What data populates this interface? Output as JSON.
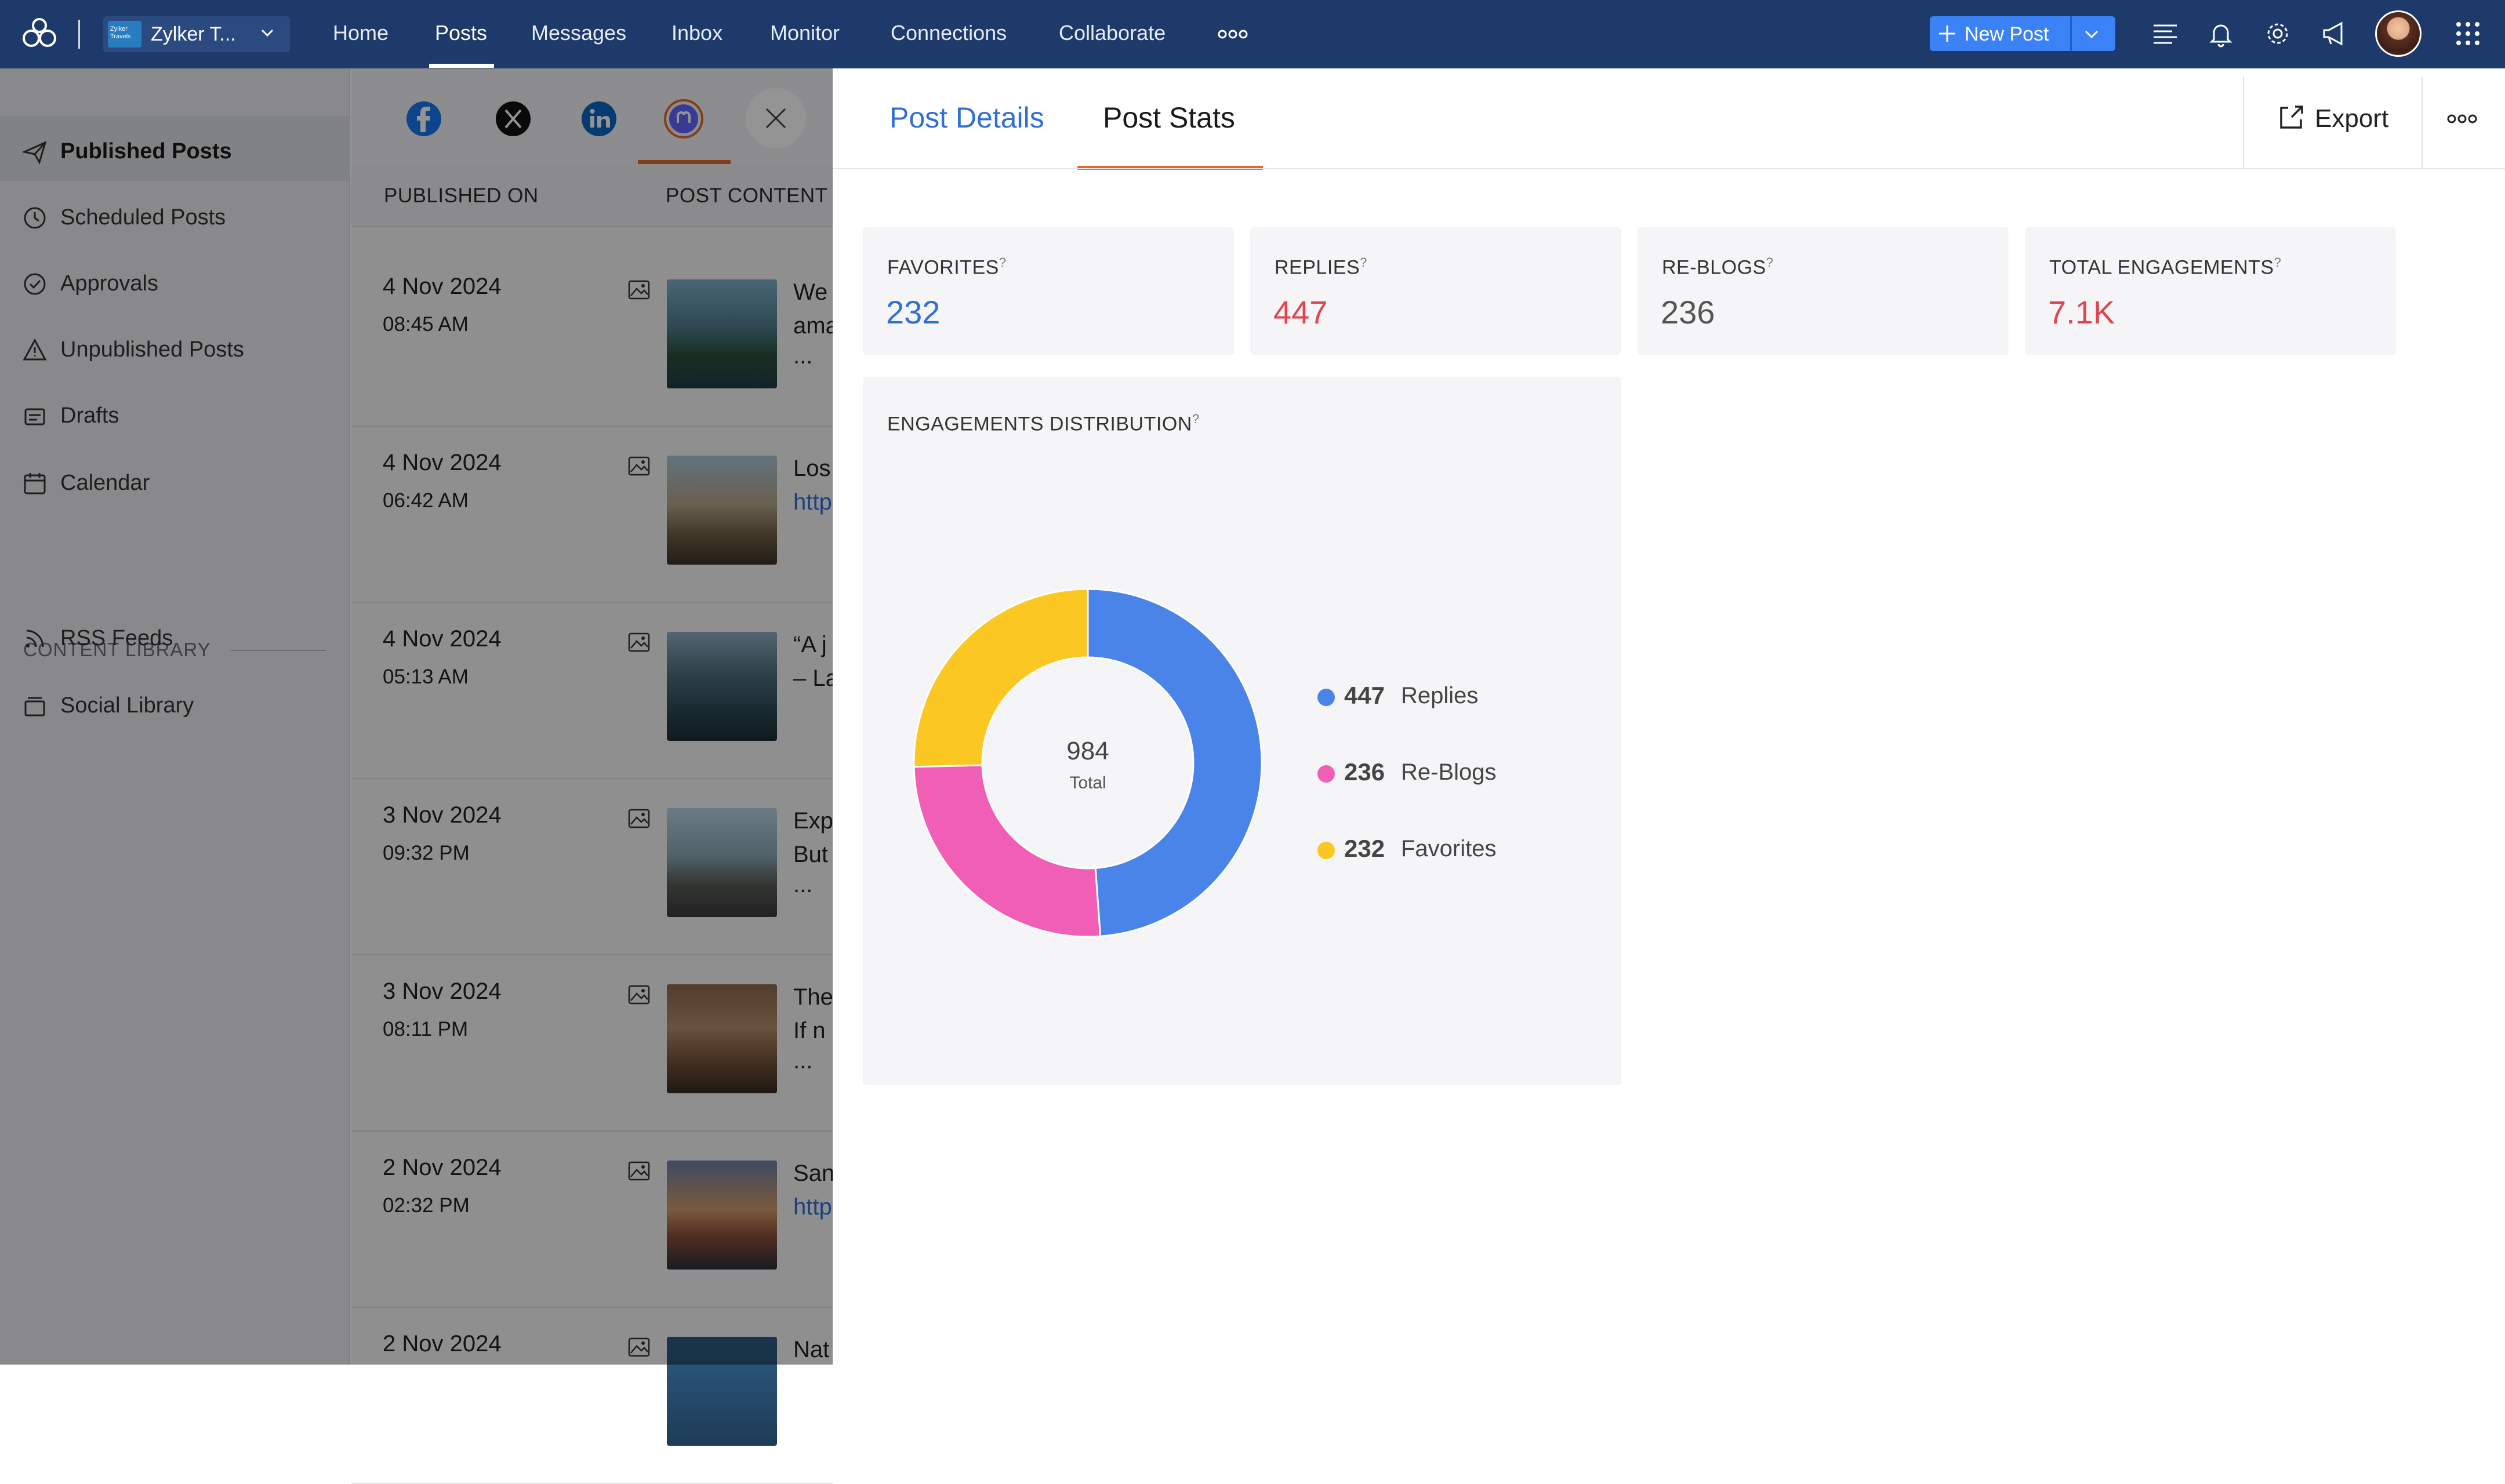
{
  "topbar": {
    "brand_name": "Zylker T...",
    "brand_badge_text": "Zylker Travels",
    "nav": [
      "Home",
      "Posts",
      "Messages",
      "Inbox",
      "Monitor",
      "Connections",
      "Collaborate"
    ],
    "active_nav": "Posts",
    "new_post_label": "New Post",
    "icons": [
      "app-logo-icon",
      "more-horizontal-icon",
      "plus-icon",
      "chevron-down-icon",
      "list-icon",
      "bell-icon",
      "gear-icon",
      "megaphone-icon",
      "grid-apps-icon"
    ]
  },
  "sidebar": {
    "items": [
      {
        "label": "Published Posts",
        "icon": "send-icon",
        "active": true
      },
      {
        "label": "Scheduled Posts",
        "icon": "clock-icon",
        "active": false
      },
      {
        "label": "Approvals",
        "icon": "check-circle-icon",
        "active": false
      },
      {
        "label": "Unpublished Posts",
        "icon": "warning-icon",
        "active": false
      },
      {
        "label": "Drafts",
        "icon": "drafts-icon",
        "active": false
      },
      {
        "label": "Calendar",
        "icon": "calendar-icon",
        "active": false
      }
    ],
    "library_heading": "CONTENT LIBRARY",
    "library_items": [
      {
        "label": "RSS Feeds",
        "icon": "rss-icon"
      },
      {
        "label": "Social Library",
        "icon": "library-icon"
      }
    ]
  },
  "posts_list": {
    "networks": [
      "facebook",
      "x",
      "linkedin",
      "mastodon"
    ],
    "active_network": "mastodon",
    "columns": [
      "PUBLISHED ON",
      "POST CONTENT"
    ],
    "rows": [
      {
        "date": "4 Nov 2024",
        "time": "08:45 AM",
        "line1": "We",
        "line2": "ama",
        "ellipsis": "...",
        "link": false
      },
      {
        "date": "4 Nov 2024",
        "time": "06:42 AM",
        "line1": "Los",
        "line2": "http",
        "ellipsis": "",
        "link": true
      },
      {
        "date": "4 Nov 2024",
        "time": "05:13 AM",
        "line1": "“A j",
        "line2": "– La",
        "ellipsis": "",
        "link": false
      },
      {
        "date": "3 Nov 2024",
        "time": "09:32 PM",
        "line1": "Exp",
        "line2": "But",
        "ellipsis": "...",
        "link": false
      },
      {
        "date": "3 Nov 2024",
        "time": "08:11 PM",
        "line1": "The",
        "line2": "If n",
        "ellipsis": "...",
        "link": false
      },
      {
        "date": "2 Nov 2024",
        "time": "02:32 PM",
        "line1": "San",
        "line2": "http",
        "ellipsis": "",
        "link": true
      },
      {
        "date": "2 Nov 2024",
        "time": "",
        "line1": "Nat",
        "line2": "",
        "ellipsis": "",
        "link": false
      }
    ]
  },
  "panel": {
    "tabs": [
      "Post Details",
      "Post Stats"
    ],
    "active_tab": "Post Stats",
    "export_label": "Export",
    "stats": [
      {
        "label": "FAVORITES",
        "value": "232",
        "color": "#2f6fd6"
      },
      {
        "label": "REPLIES",
        "value": "447",
        "color": "#e0454f"
      },
      {
        "label": "RE-BLOGS",
        "value": "236",
        "color": "#555555"
      },
      {
        "label": "TOTAL ENGAGEMENTS",
        "value": "7.1K",
        "color": "#e0454f"
      }
    ],
    "distribution_title": "ENGAGEMENTS DISTRIBUTION",
    "help_mark": "?"
  },
  "chart_data": {
    "type": "pie",
    "variant": "donut",
    "center_value": "984",
    "center_label": "Total",
    "categories": [
      "Replies",
      "Re-Blogs",
      "Favorites"
    ],
    "values": [
      447,
      236,
      232
    ],
    "colors": [
      "#4a84e8",
      "#f05fb5",
      "#fbc723"
    ]
  }
}
